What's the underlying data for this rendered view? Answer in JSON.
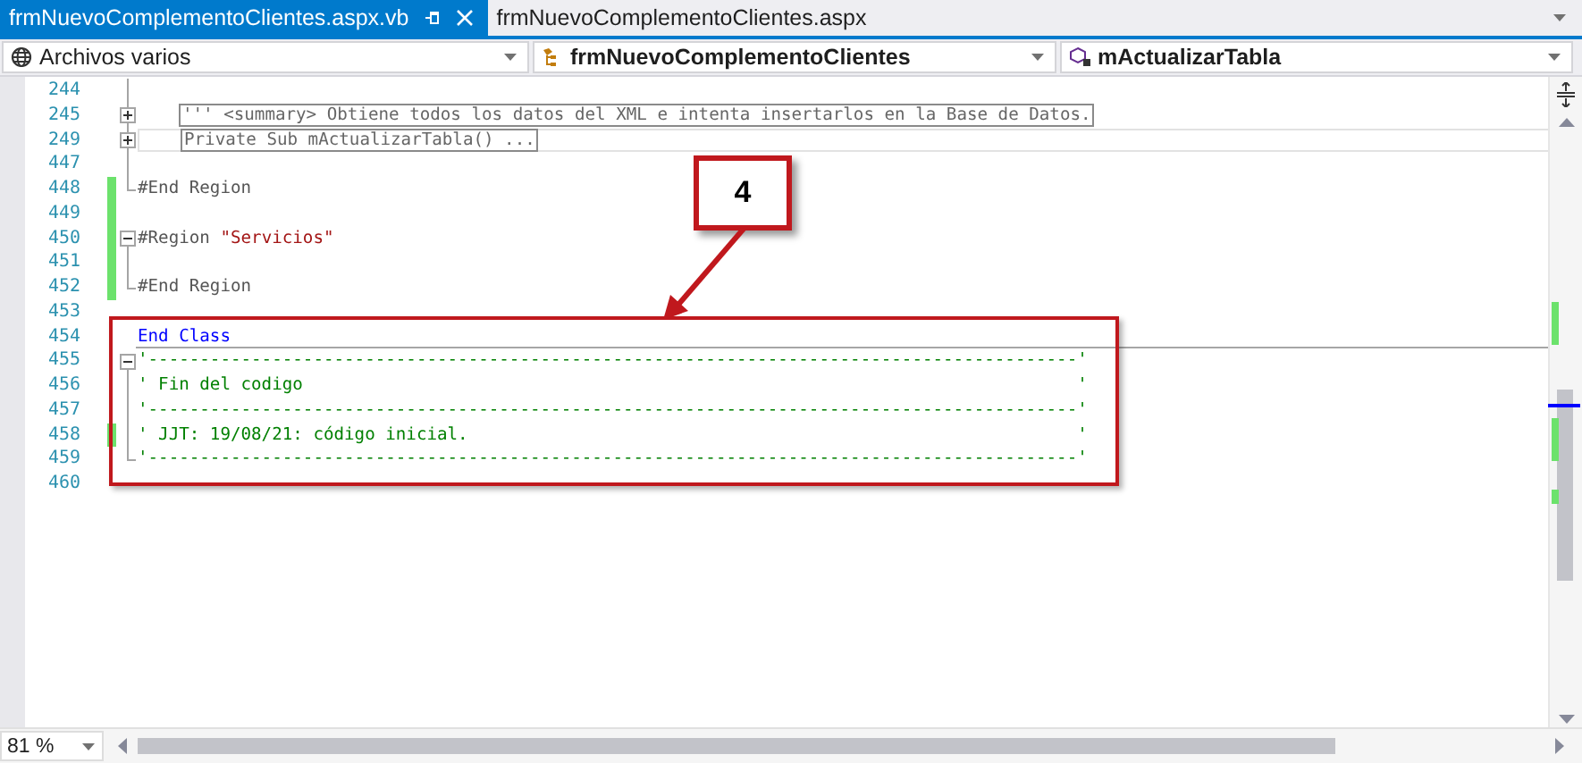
{
  "tabs": [
    {
      "label": "frmNuevoComplementoClientes.aspx.vb",
      "selected": true
    },
    {
      "label": "frmNuevoComplementoClientes.aspx",
      "selected": false
    }
  ],
  "navigation": [
    {
      "kind": "project",
      "text": "Archivos varios"
    },
    {
      "kind": "class",
      "text": "frmNuevoComplementoClientes"
    },
    {
      "kind": "method",
      "text": "mActualizarTabla"
    }
  ],
  "editor": {
    "lines": [
      {
        "number": "244",
        "kind": "body",
        "changed": false,
        "current": false,
        "separator_below": false
      },
      {
        "number": "245",
        "kind": "header",
        "expanded": false,
        "changed": false,
        "current": false,
        "separator_below": false,
        "tokens": [
          {
            "kind": "collapsed",
            "text": "''' <summary> Obtiene todos los datos del XML e intenta insertarlos en la Base de Datos."
          }
        ]
      },
      {
        "number": "249",
        "kind": "header",
        "expanded": false,
        "changed": false,
        "current": true,
        "separator_below": false,
        "tokens": [
          {
            "kind": "collapsed",
            "text": "Private Sub mActualizarTabla() ..."
          }
        ]
      },
      {
        "number": "447",
        "kind": "body",
        "changed": false,
        "current": false,
        "separator_below": false
      },
      {
        "number": "448",
        "kind": "end",
        "changed": true,
        "current": false,
        "separator_below": false,
        "tokens": [
          {
            "kind": "plain",
            "text": "#End Region"
          }
        ]
      },
      {
        "number": "449",
        "kind": "blank",
        "changed": true,
        "current": false,
        "separator_below": false
      },
      {
        "number": "450",
        "kind": "header",
        "expanded": true,
        "changed": true,
        "current": false,
        "separator_below": false,
        "tokens": [
          {
            "kind": "plain",
            "text": "#Region "
          },
          {
            "kind": "string",
            "text": "\"Servicios\""
          }
        ]
      },
      {
        "number": "451",
        "kind": "body",
        "changed": true,
        "current": false,
        "separator_below": false
      },
      {
        "number": "452",
        "kind": "end",
        "changed": true,
        "current": false,
        "separator_below": false,
        "tokens": [
          {
            "kind": "plain",
            "text": "#End Region"
          }
        ]
      },
      {
        "number": "453",
        "kind": "blank",
        "changed": false,
        "current": false,
        "separator_below": false
      },
      {
        "number": "454",
        "kind": "blank",
        "changed": false,
        "current": false,
        "separator_below": true,
        "tokens": [
          {
            "kind": "keyword",
            "text": "End Class"
          }
        ]
      },
      {
        "number": "455",
        "kind": "header",
        "expanded": true,
        "changed": false,
        "current": false,
        "separator_below": false,
        "tokens": [
          {
            "kind": "comment",
            "text": "'------------------------------------------------------------------------------------------'"
          }
        ]
      },
      {
        "number": "456",
        "kind": "body",
        "changed": false,
        "current": false,
        "separator_below": false,
        "tokens": [
          {
            "kind": "comment",
            "text": "' Fin del codigo                                                                           '"
          }
        ]
      },
      {
        "number": "457",
        "kind": "body",
        "changed": false,
        "current": false,
        "separator_below": false,
        "tokens": [
          {
            "kind": "comment",
            "text": "'------------------------------------------------------------------------------------------'"
          }
        ]
      },
      {
        "number": "458",
        "kind": "body",
        "changed": true,
        "current": false,
        "separator_below": false,
        "tokens": [
          {
            "kind": "comment",
            "text": "' JJT: 19/08/21: código inicial.                                                           '"
          }
        ]
      },
      {
        "number": "459",
        "kind": "end",
        "changed": false,
        "current": false,
        "separator_below": false,
        "tokens": [
          {
            "kind": "comment",
            "text": "'------------------------------------------------------------------------------------------'"
          }
        ]
      },
      {
        "number": "460",
        "kind": "blank",
        "changed": false,
        "current": false,
        "separator_below": false
      }
    ]
  },
  "callout": {
    "label": "4"
  },
  "zoom": {
    "value": "81 %"
  }
}
